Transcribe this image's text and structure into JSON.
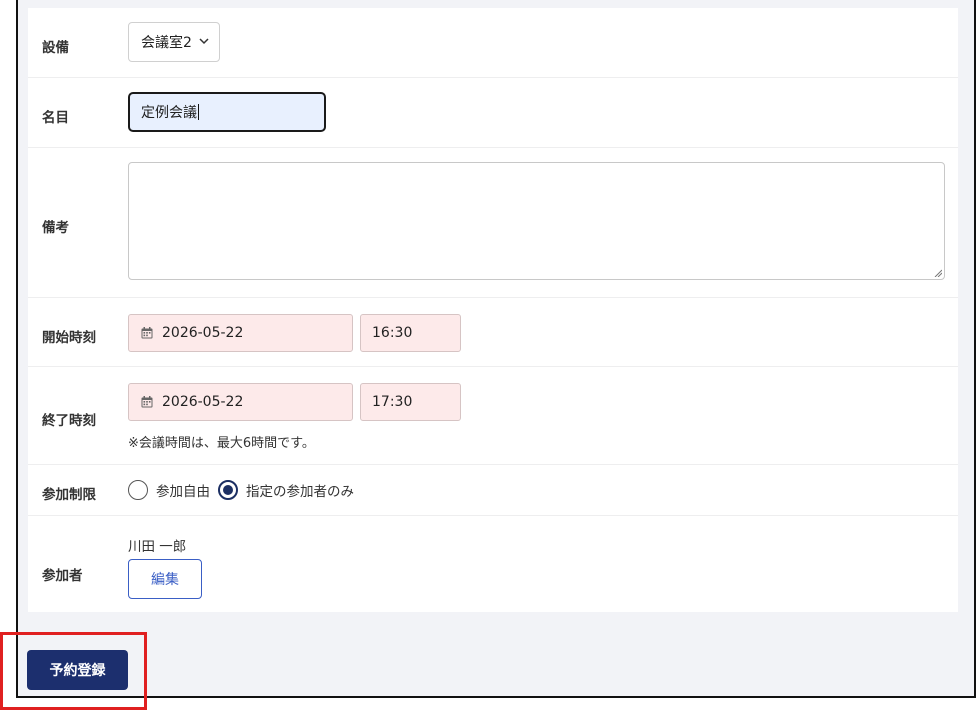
{
  "form": {
    "equipment": {
      "label": "設備",
      "value": "会議室2"
    },
    "title": {
      "label": "名目",
      "value": "定例会議"
    },
    "remarks": {
      "label": "備考",
      "value": ""
    },
    "start": {
      "label": "開始時刻",
      "date": "2026-05-22",
      "time": "16:30"
    },
    "end": {
      "label": "終了時刻",
      "date": "2026-05-22",
      "time": "17:30",
      "note": "※会議時間は、最大6時間です。"
    },
    "restriction": {
      "label": "参加制限",
      "options": [
        {
          "label": "参加自由",
          "checked": false
        },
        {
          "label": "指定の参加者のみ",
          "checked": true
        }
      ]
    },
    "participants": {
      "label": "参加者",
      "names": [
        "川田 一郎"
      ],
      "edit_label": "編集"
    }
  },
  "actions": {
    "submit_label": "予約登録"
  },
  "colors": {
    "primary": "#1c2f6e",
    "highlight": "#e02020",
    "invalid_bg": "#fdeaea",
    "autofill_bg": "#e8f0fe"
  },
  "icons": {
    "select": "chevron-down-icon",
    "date": "calendar-icon",
    "resize": "resize-grip-icon"
  }
}
